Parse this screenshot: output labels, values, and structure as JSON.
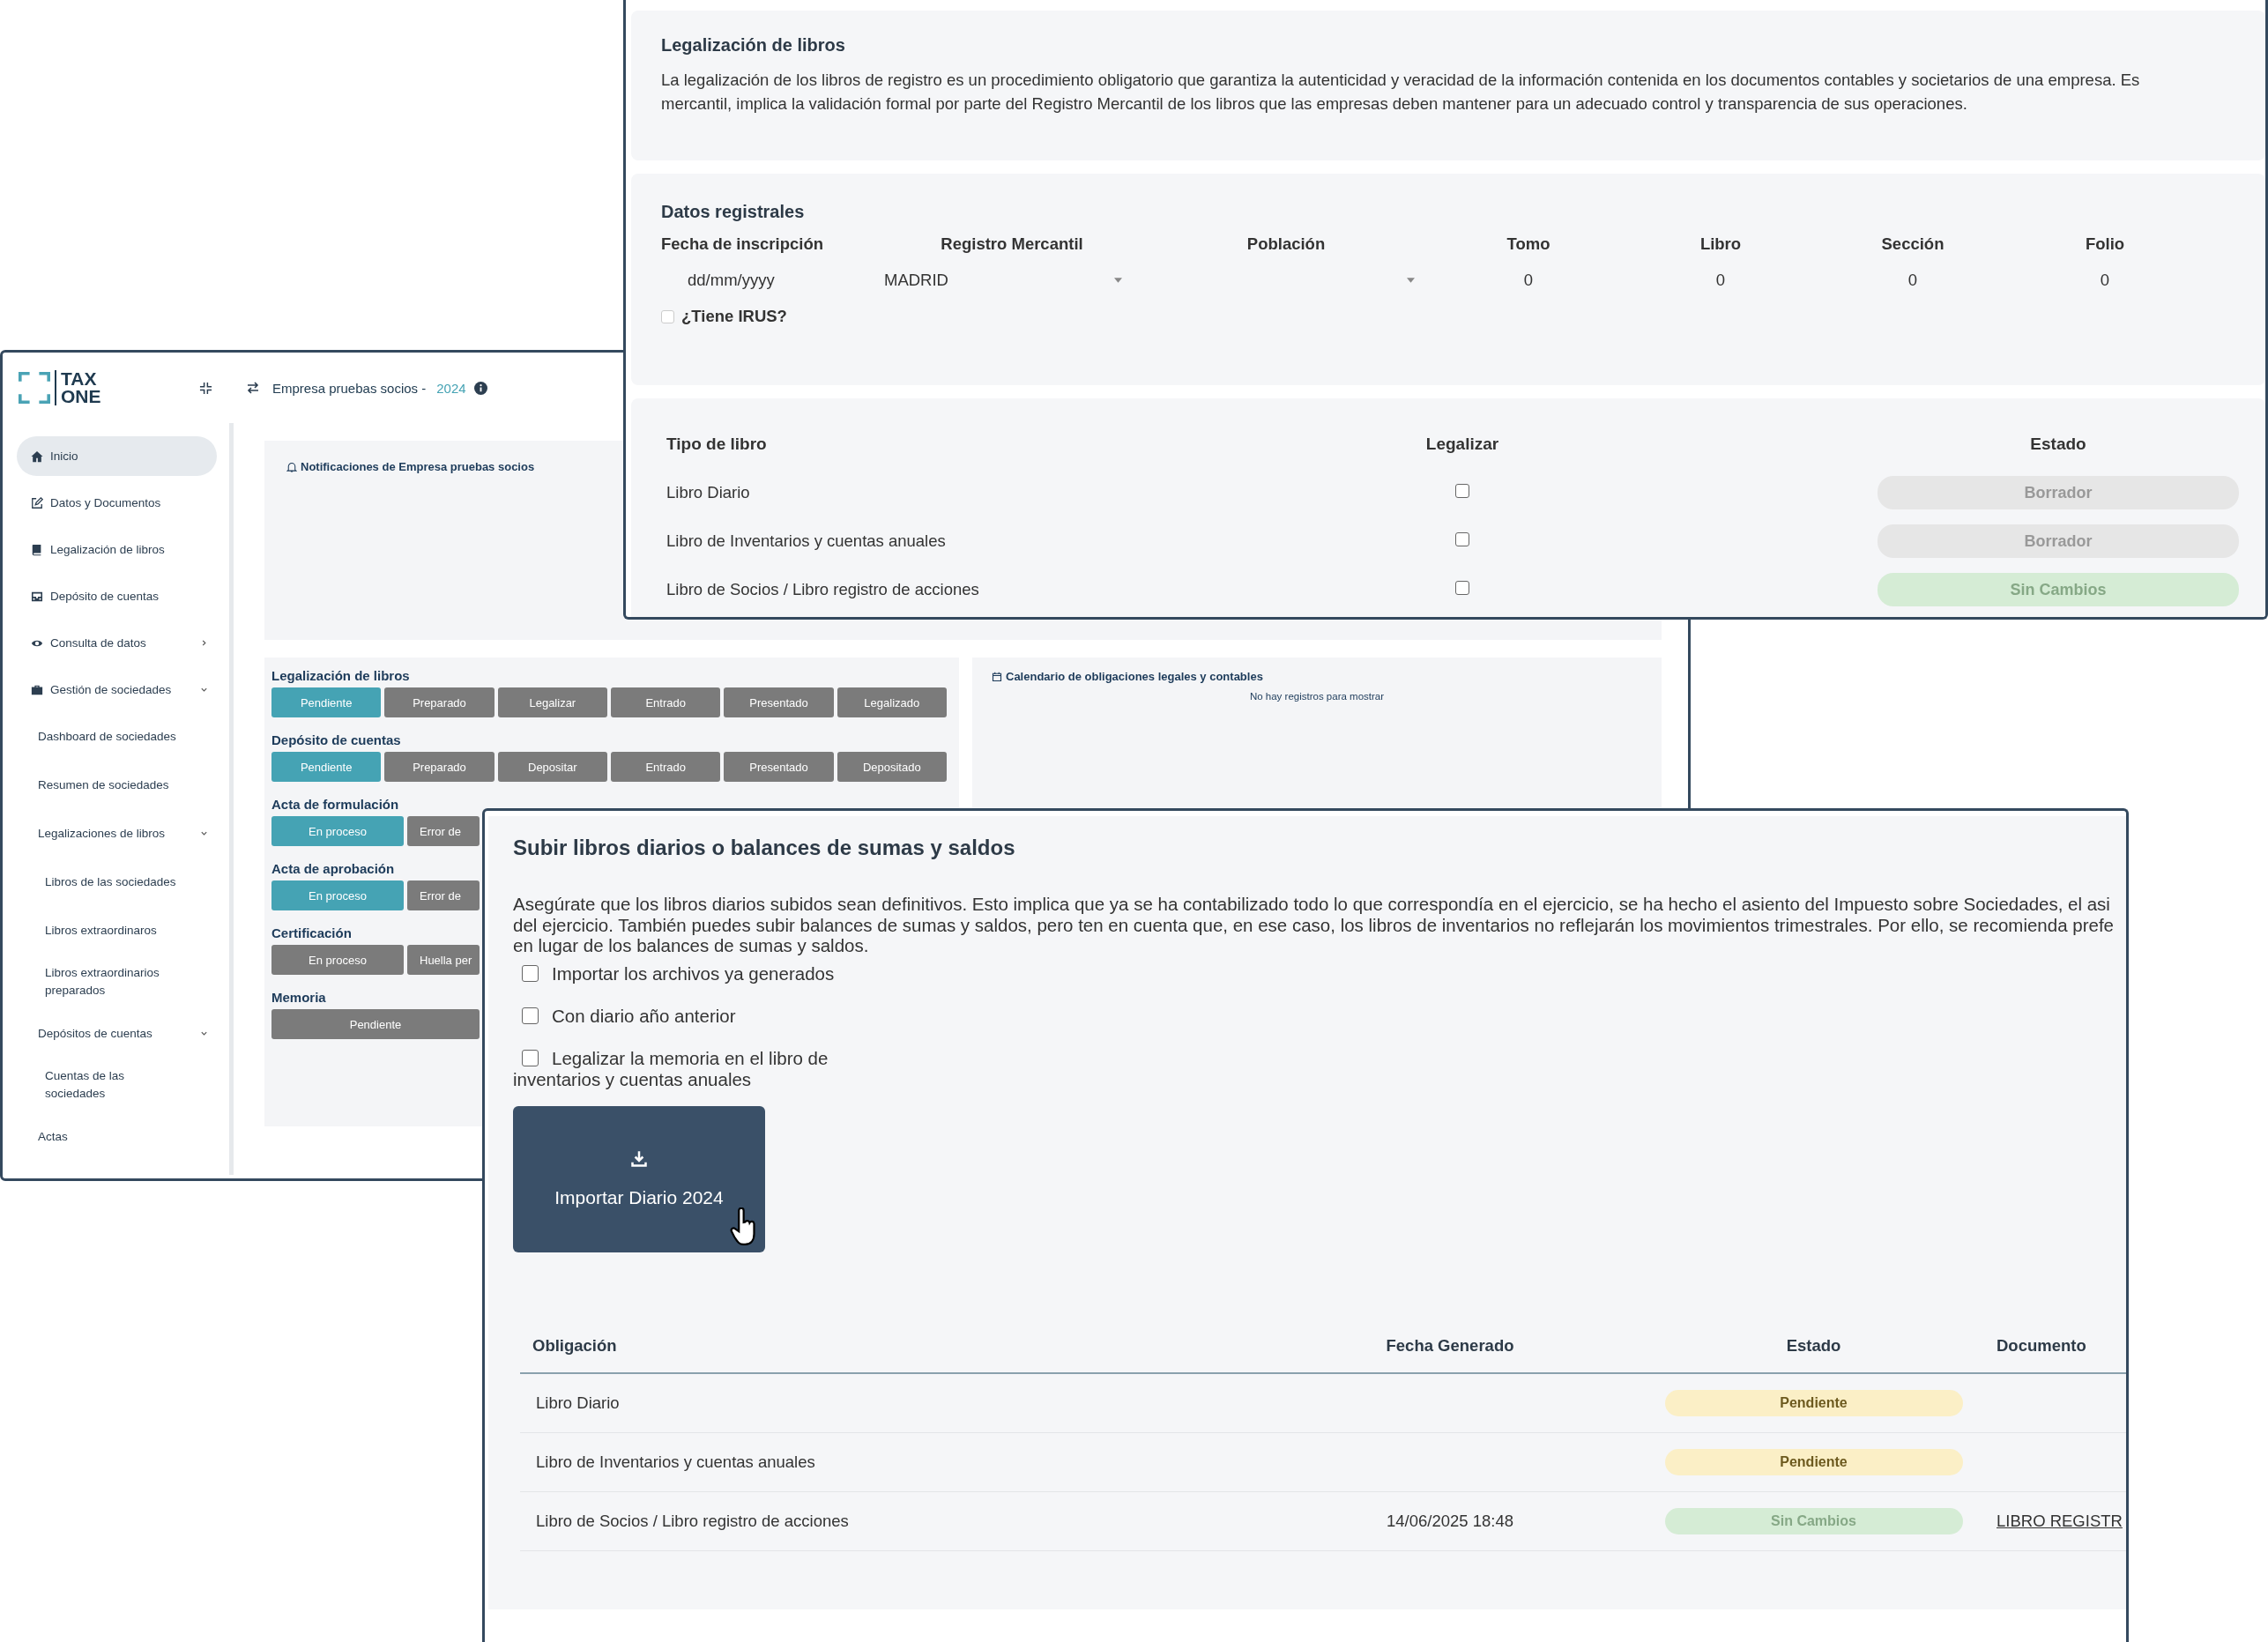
{
  "app_window": {
    "logo": [
      "TAX",
      "ONE"
    ],
    "company": "Empresa pruebas socios -",
    "year": "2024",
    "sidebar": {
      "items": [
        {
          "label": "Inicio",
          "selected": true
        },
        {
          "label": "Datos y Documentos",
          "selected": false
        },
        {
          "label": "Legalización de libros",
          "selected": false
        },
        {
          "label": "Depósito de cuentas",
          "selected": false
        },
        {
          "label": "Consulta de datos",
          "selected": false,
          "expanded": false
        },
        {
          "label": "Gestión de sociedades",
          "selected": false,
          "expanded": true,
          "children": [
            {
              "label": "Dashboard de sociedades",
              "selected": false
            },
            {
              "label": "Resumen de sociedades",
              "selected": false
            },
            {
              "label": "Legalizaciones de libros",
              "selected": false,
              "expanded": true,
              "children": [
                {
                  "label": "Libros de las sociedades",
                  "selected": false
                },
                {
                  "label": "Libros extraordinaros",
                  "selected": false
                },
                {
                  "label": "Libros extraordinarios preparados",
                  "selected": false
                }
              ]
            },
            {
              "label": "Depósitos de cuentas",
              "selected": false,
              "expanded": true,
              "children": [
                {
                  "label": "Cuentas de las sociedades",
                  "selected": false
                }
              ]
            },
            {
              "label": "Actas",
              "selected": false
            }
          ]
        }
      ]
    },
    "notifications": {
      "title": "Notificaciones de Empresa pruebas socios"
    },
    "status_groups": [
      {
        "title": "Legalización de libros",
        "steps": [
          {
            "label": "Pendiente",
            "active": true
          },
          {
            "label": "Preparado",
            "active": false
          },
          {
            "label": "Legalizar",
            "active": false
          },
          {
            "label": "Entrado",
            "active": false
          },
          {
            "label": "Presentado",
            "active": false
          },
          {
            "label": "Legalizado",
            "active": false
          }
        ]
      },
      {
        "title": "Depósito de cuentas",
        "steps": [
          {
            "label": "Pendiente",
            "active": true
          },
          {
            "label": "Preparado",
            "active": false
          },
          {
            "label": "Depositar",
            "active": false
          },
          {
            "label": "Entrado",
            "active": false
          },
          {
            "label": "Presentado",
            "active": false
          },
          {
            "label": "Depositado",
            "active": false
          }
        ]
      },
      {
        "title": "Acta de formulación",
        "steps": [
          {
            "label": "En proceso",
            "active": true
          },
          {
            "label": "Error de",
            "active": false
          }
        ]
      },
      {
        "title": "Acta de aprobación",
        "steps": [
          {
            "label": "En proceso",
            "active": true
          },
          {
            "label": "Error de",
            "active": false
          }
        ]
      },
      {
        "title": "Certificación",
        "steps": [
          {
            "label": "En proceso",
            "active": false
          },
          {
            "label": "Huella per",
            "active": false
          }
        ]
      },
      {
        "title": "Memoria",
        "steps": [
          {
            "label": "Pendiente",
            "active": false
          }
        ]
      }
    ],
    "calendar": {
      "title": "Calendario de obligaciones legales y contables",
      "empty": "No hay registros para mostrar"
    }
  },
  "legalizacion_panel": {
    "title": "Legalización de libros",
    "description_lines": [
      "La legalización de los libros de registro es un procedimiento obligatorio que garantiza la autenticidad y veracidad de la información contenida en los documentos contables y societarios de una empresa. Es",
      "mercantil, implica la validación formal por parte del Registro Mercantil de los libros que las empresas deben mantener para un adecuado control y transparencia de sus operaciones."
    ],
    "registro": {
      "title": "Datos registrales",
      "fields": [
        {
          "label": "Fecha de inscripción",
          "kind": "date",
          "placeholder": "dd/mm/yyyy"
        },
        {
          "label": "Registro Mercantil",
          "kind": "select",
          "value": "MADRID"
        },
        {
          "label": "Población",
          "kind": "select"
        },
        {
          "label": "Tomo",
          "kind": "number",
          "value": "0"
        },
        {
          "label": "Libro",
          "kind": "number",
          "value": "0"
        },
        {
          "label": "Sección",
          "kind": "number",
          "value": "0"
        },
        {
          "label": "Folio",
          "kind": "number",
          "value": "0"
        }
      ],
      "irus": {
        "label": "¿Tiene IRUS?",
        "checked": false
      }
    },
    "books": {
      "columns": [
        "Tipo de libro",
        "Legalizar",
        "Estado"
      ],
      "rows": [
        {
          "name": "Libro Diario",
          "checked": false,
          "status": "Borrador",
          "kind": "draft"
        },
        {
          "name": "Libro de Inventarios y cuentas anuales",
          "checked": false,
          "status": "Borrador",
          "kind": "draft"
        },
        {
          "name": "Libro de Socios / Libro registro de acciones",
          "checked": false,
          "status": "Sin Cambios",
          "kind": "unchanged"
        }
      ]
    }
  },
  "upload_panel": {
    "title": "Subir libros diarios o balances de sumas y saldos",
    "description_lines": [
      "Asegúrate que los libros diarios subidos sean definitivos. Esto implica que ya se ha contabilizado todo lo que correspondía en el ejercicio, se ha hecho el asiento del Impuesto sobre Sociedades, el asi",
      "del ejercicio. También puedes subir balances de sumas y saldos, pero ten en cuenta que, en ese caso, los libros de inventarios no reflejarán los movimientos trimestrales. Por ello, se recomienda prefe",
      "en lugar de los balances de sumas y saldos."
    ],
    "options": [
      {
        "label": "Importar los archivos ya generados",
        "checked": false
      },
      {
        "label": "Con diario año anterior",
        "checked": false
      },
      {
        "label": "Legalizar la memoria en el libro de inventarios y cuentas anuales",
        "checked": false
      }
    ],
    "import_button": "Importar Diario 2024",
    "table": {
      "columns": [
        "Obligación",
        "Fecha Generado",
        "Estado",
        "Documento"
      ],
      "rows": [
        {
          "obligation": "Libro Diario",
          "status": "Pendiente",
          "kind": "pending"
        },
        {
          "obligation": "Libro de Inventarios y cuentas anuales",
          "status": "Pendiente",
          "kind": "pending"
        },
        {
          "obligation": "Libro de Socios / Libro registro de acciones",
          "date": "14/06/2025 18:48",
          "status": "Sin Cambios",
          "kind": "unchanged",
          "document": "LIBRO REGISTR"
        }
      ]
    }
  }
}
